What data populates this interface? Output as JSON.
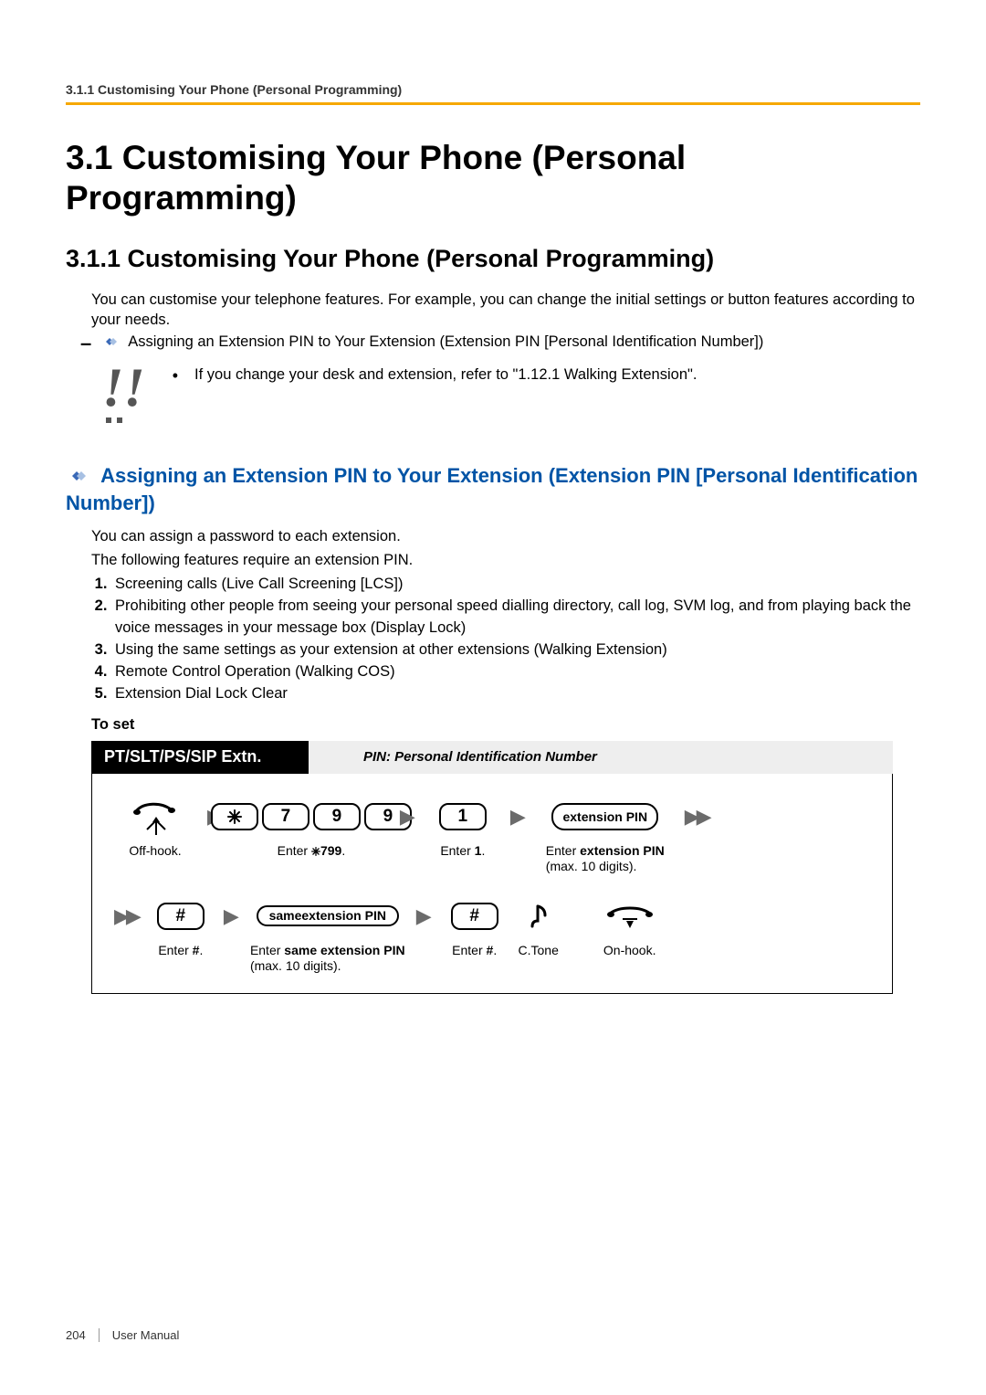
{
  "running_head": "3.1.1 Customising Your Phone (Personal Programming)",
  "h1": "3.1  Customising Your Phone (Personal Programming)",
  "h2": "3.1.1  Customising Your Phone (Personal Programming)",
  "intro1": "You can customise your telephone features. For example, you can change the initial settings or button features according to your needs.",
  "dash_item": "Assigning an Extension PIN to Your Extension (Extension PIN [Personal Identification Number])",
  "note_item": "If you change your desk and extension, refer to \"1.12.1  Walking Extension\".",
  "blue_heading": "Assigning an Extension PIN to Your Extension (Extension PIN [Personal Identification Number])",
  "blue_p1": "You can assign a password to each extension.",
  "blue_p2": "The following features require an extension PIN.",
  "features": [
    "Screening calls (Live Call Screening [LCS])",
    "Prohibiting other people from seeing your personal speed dialling directory, call log, SVM log, and from playing back the voice messages in your message box (Display Lock)",
    "Using the same settings as your extension at other extensions (Walking Extension)",
    "Remote Control Operation (Walking COS)",
    "Extension Dial Lock Clear"
  ],
  "to_set": "To set",
  "proc": {
    "black": "PT/SLT/PS/SIP Extn.",
    "grey": "PIN: Personal Identification Number",
    "row1": {
      "offhook": "Off-hook.",
      "keys1": [
        "7",
        "9",
        "9"
      ],
      "cap1_pre": "Enter ",
      "cap1_bold": "799",
      "cap1_post": ".",
      "key2": "1",
      "cap2_pre": "Enter ",
      "cap2_bold": "1",
      "cap2_post": ".",
      "pill3": "extension PIN",
      "cap3_pre": "Enter ",
      "cap3_bold": "extension PIN",
      "cap3_line2": "(max. 10 digits)."
    },
    "row2": {
      "keyA": "#",
      "capA_pre": "Enter ",
      "capA_bold": "#",
      "capA_post": ".",
      "pillB_l1": "same",
      "pillB_l2": "extension PIN",
      "capB_pre": "Enter ",
      "capB_bold": "same extension PIN",
      "capB_line2": "(max. 10 digits).",
      "keyC": "#",
      "capC_pre": "Enter ",
      "capC_bold": "#",
      "capC_post": ".",
      "ctone": "C.Tone",
      "onhook": "On-hook."
    }
  },
  "footer": {
    "page": "204",
    "doc": "User Manual"
  }
}
